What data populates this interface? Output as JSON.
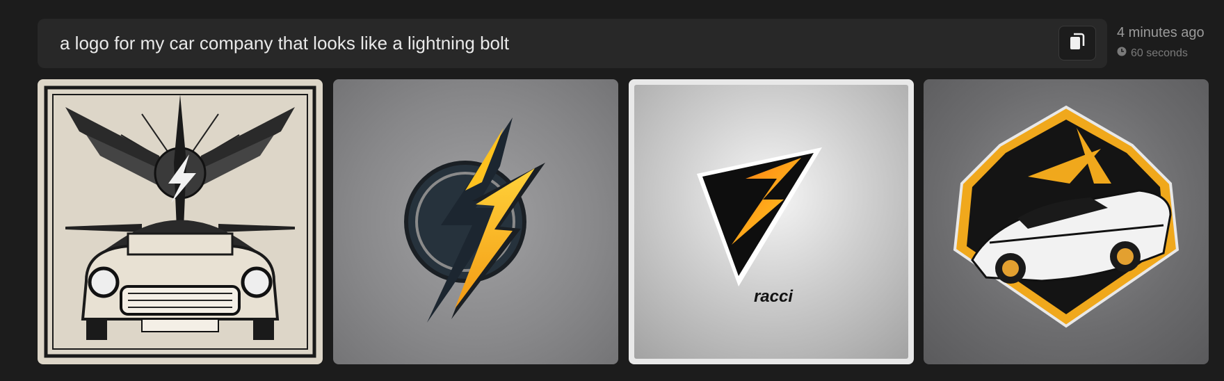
{
  "prompt": {
    "text": "a logo for my car company that looks like a lightning bolt"
  },
  "copy_button": {
    "icon": "copy-icon"
  },
  "meta": {
    "time_ago": "4 minutes ago",
    "duration": "60 seconds",
    "duration_icon": "clock-icon"
  },
  "images": [
    {
      "name": "generated-image-1"
    },
    {
      "name": "generated-image-2"
    },
    {
      "name": "generated-image-3",
      "selected": true,
      "logo_text": "racci"
    },
    {
      "name": "generated-image-4"
    }
  ]
}
